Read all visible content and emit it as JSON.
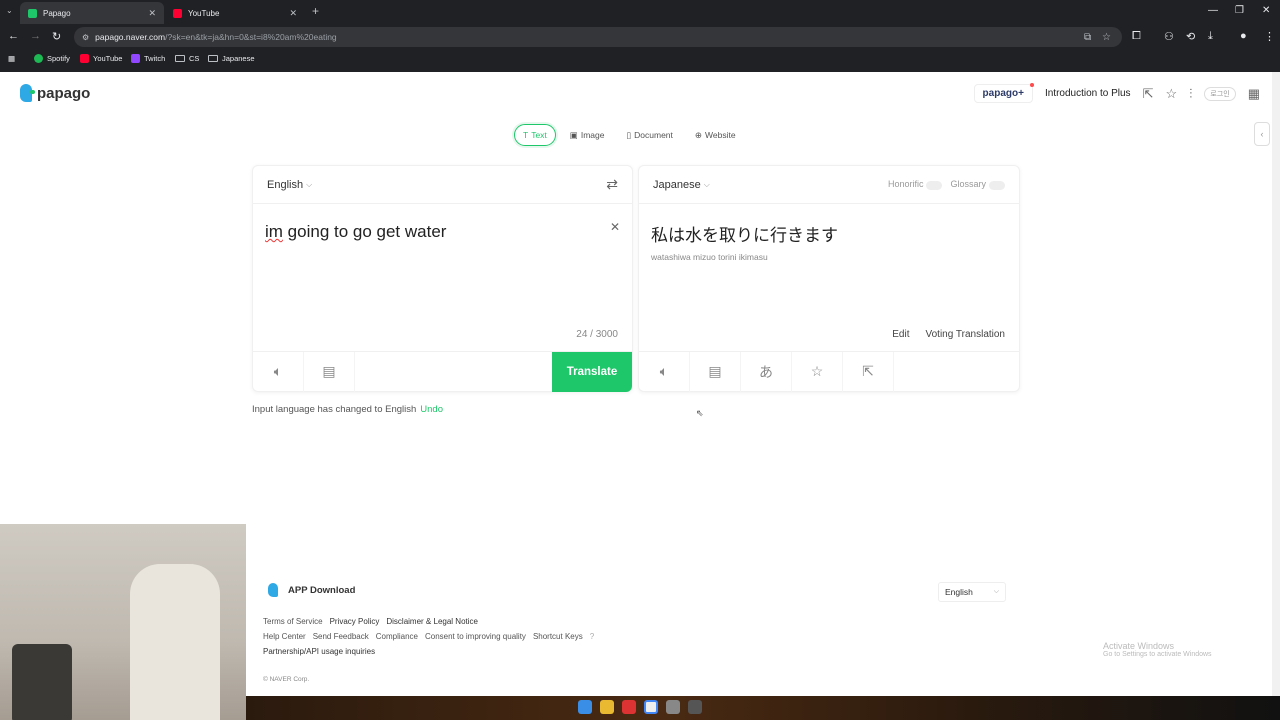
{
  "browser": {
    "tabs": [
      {
        "title": "Papago",
        "active": true,
        "color": "#1ec76a"
      },
      {
        "title": "YouTube",
        "active": false,
        "color": "#ff0033"
      }
    ],
    "url_host": "papago.naver.com",
    "url_path": "/?sk=en&tk=ja&hn=0&st=i8%20am%20eating",
    "bookmarks": [
      {
        "label": "Spotify",
        "color": "#1db954"
      },
      {
        "label": "YouTube",
        "color": "#ff0033"
      },
      {
        "label": "Twitch",
        "color": "#9146ff"
      },
      {
        "label": "CS"
      },
      {
        "label": "Japanese"
      }
    ]
  },
  "header": {
    "logo": "papago",
    "plus": "papago+",
    "intro": "Introduction to Plus",
    "login": "로그인"
  },
  "modes": [
    {
      "label": "Text",
      "icon": "T",
      "active": true
    },
    {
      "label": "Image",
      "icon": "▣"
    },
    {
      "label": "Document",
      "icon": "▯"
    },
    {
      "label": "Website",
      "icon": "⊕"
    }
  ],
  "source": {
    "lang": "English",
    "text_a": "im",
    "text_b": " going to go get water",
    "count": "24 / 3000",
    "translate": "Translate"
  },
  "target": {
    "lang": "Japanese",
    "honorific": "Honorific",
    "glossary": "Glossary",
    "text": "私は水を取りに行きます",
    "romaji": "watashiwa mizuo torini ikimasu",
    "edit": "Edit",
    "voting": "Voting Translation"
  },
  "notice": {
    "text": "Input language has changed to English",
    "undo": "Undo"
  },
  "footer": {
    "app": "APP Download",
    "lang": "English",
    "row1": [
      "Terms of Service",
      "Privacy Policy",
      "Disclaimer & Legal Notice"
    ],
    "row2": [
      "Help Center",
      "Send Feedback",
      "Compliance",
      "Consent to improving quality",
      "Shortcut Keys"
    ],
    "row3": "Partnership/API usage inquiries",
    "copyright": "© NAVER Corp."
  },
  "watermark": {
    "title": "Activate Windows",
    "sub": "Go to Settings to activate Windows"
  }
}
